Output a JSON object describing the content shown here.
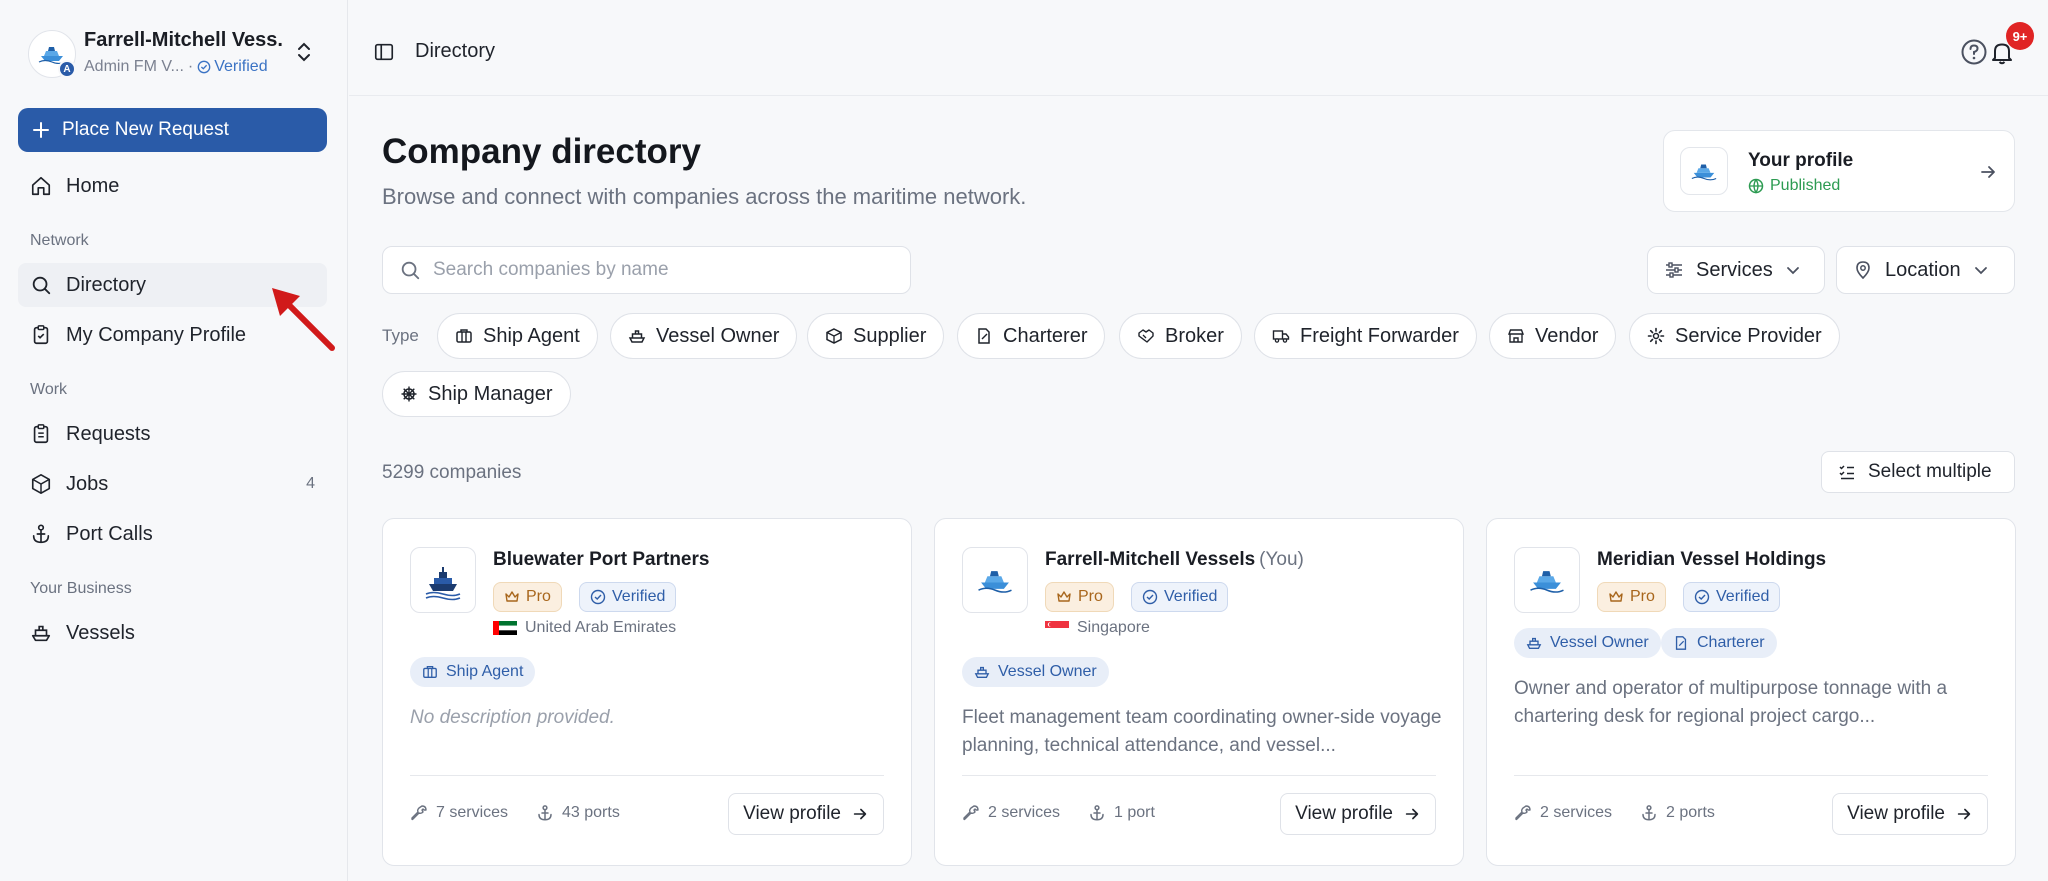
{
  "org": {
    "name": "Farrell-Mitchell Vess...",
    "badge_letter": "A",
    "role": "Admin FM V...",
    "separator": "·",
    "verified": "Verified"
  },
  "sidebar": {
    "primary_button": "Place New Request",
    "home": "Home",
    "sections": [
      {
        "label": "Network",
        "items": [
          {
            "label": "Directory"
          },
          {
            "label": "My Company Profile"
          }
        ]
      },
      {
        "label": "Work",
        "items": [
          {
            "label": "Requests"
          },
          {
            "label": "Jobs",
            "count": "4"
          },
          {
            "label": "Port Calls"
          }
        ]
      },
      {
        "label": "Your Business",
        "items": [
          {
            "label": "Vessels"
          }
        ]
      }
    ]
  },
  "topbar": {
    "breadcrumb": "Directory",
    "notification_count": "9+"
  },
  "header": {
    "title": "Company directory",
    "subtitle": "Browse and connect with companies across the maritime network."
  },
  "profile_card": {
    "title": "Your profile",
    "status": "Published"
  },
  "filters": {
    "search_placeholder": "Search companies by name",
    "services": "Services",
    "location": "Location",
    "type_label": "Type",
    "types": [
      "Ship Agent",
      "Vessel Owner",
      "Supplier",
      "Charterer",
      "Broker",
      "Freight Forwarder",
      "Vendor",
      "Service Provider",
      "Ship Manager"
    ]
  },
  "results": {
    "count": "5299 companies",
    "select_multiple": "Select multiple"
  },
  "cards": [
    {
      "name": "Bluewater Port Partners",
      "you": "",
      "pro": "Pro",
      "verified": "Verified",
      "country": "United Arab Emirates",
      "types": [
        "Ship Agent"
      ],
      "description": "No description provided.",
      "services": "7 services",
      "ports": "43 ports",
      "button": "View profile"
    },
    {
      "name": "Farrell-Mitchell Vessels",
      "you": "(You)",
      "pro": "Pro",
      "verified": "Verified",
      "country": "Singapore",
      "types": [
        "Vessel Owner"
      ],
      "description": "Fleet management team coordinating owner-side voyage planning, technical attendance, and vessel...",
      "services": "2 services",
      "ports": "1 port",
      "button": "View profile"
    },
    {
      "name": "Meridian Vessel Holdings",
      "you": "",
      "pro": "Pro",
      "verified": "Verified",
      "country": "",
      "types": [
        "Vessel Owner",
        "Charterer"
      ],
      "description": "Owner and operator of multipurpose tonnage with a chartering desk for regional project cargo...",
      "services": "2 services",
      "ports": "2 ports",
      "button": "View profile"
    }
  ],
  "colors": {
    "primary": "#2a5ba8",
    "published": "#2d9b52",
    "pro": "#a8661c",
    "annotation_arrow": "#d11a1a",
    "notification": "#e02424"
  }
}
